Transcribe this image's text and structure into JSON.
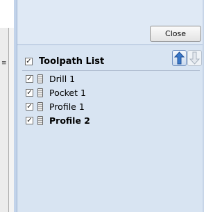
{
  "toolbar": {
    "close_label": "Close"
  },
  "toolpath_list": {
    "title": "Toolpath List",
    "header_checked": true,
    "items": [
      {
        "label": "Drill 1",
        "checked": true,
        "bold": false
      },
      {
        "label": "Pocket 1",
        "checked": true,
        "bold": false
      },
      {
        "label": "Profile 1",
        "checked": true,
        "bold": false
      },
      {
        "label": "Profile 2",
        "checked": true,
        "bold": true
      }
    ],
    "move_up": {
      "icon": "arrow-up-icon",
      "enabled": true
    },
    "move_down": {
      "icon": "arrow-down-icon",
      "enabled": false
    }
  },
  "colors": {
    "panel_bg": "#d8e4f2",
    "accent_blue": "#3a78c9"
  }
}
